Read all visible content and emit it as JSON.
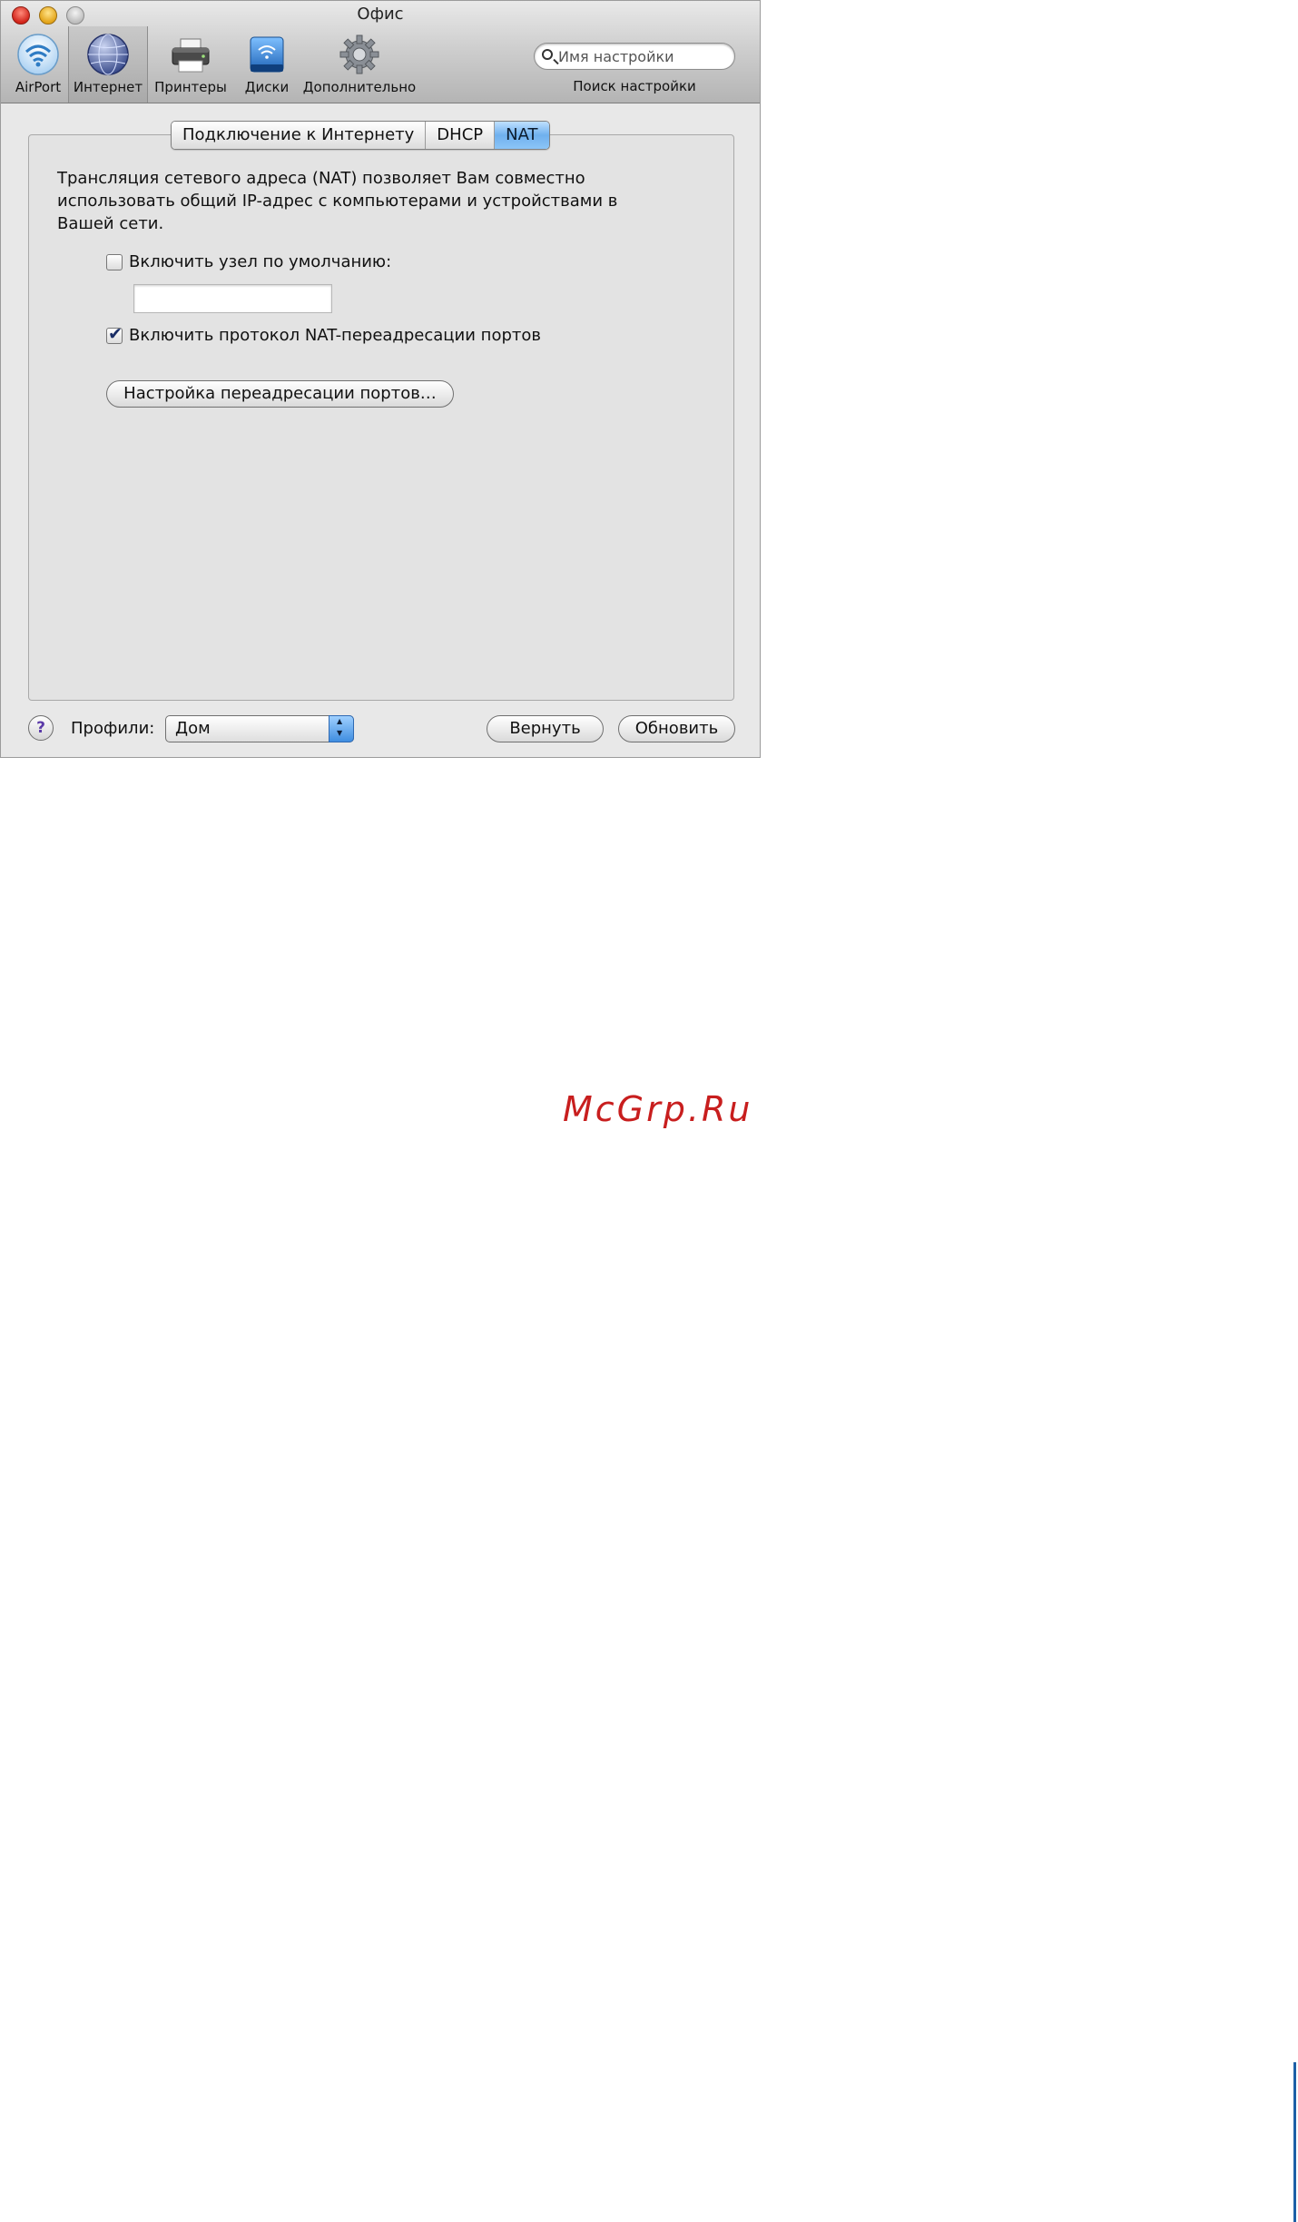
{
  "window": {
    "title": "Офис"
  },
  "toolbar": {
    "items": [
      {
        "label": "AirPort",
        "icon": "airport-wifi-icon"
      },
      {
        "label": "Интернет",
        "icon": "globe-icon",
        "active": true
      },
      {
        "label": "Принтеры",
        "icon": "printer-icon"
      },
      {
        "label": "Диски",
        "icon": "disk-icon"
      },
      {
        "label": "Дополнительно",
        "icon": "gear-icon"
      }
    ],
    "search": {
      "placeholder": "Имя настройки",
      "caption": "Поиск настройки"
    }
  },
  "tabs": [
    {
      "label": "Подключение к Интернету",
      "active": false
    },
    {
      "label": "DHCP",
      "active": false
    },
    {
      "label": "NAT",
      "active": true
    }
  ],
  "nat": {
    "description": "Трансляция сетевого адреса (NAT) позволяет Вам совместно использовать общий IP-адрес с компьютерами и устройствами в Вашей сети.",
    "default_host_label": "Включить узел по умолчанию:",
    "default_host_checked": false,
    "default_host_value": "",
    "port_mapping_label": "Включить протокол NAT-переадресации портов",
    "port_mapping_checked": true,
    "port_forwarding_button": "Настройка переадресации портов…"
  },
  "footer": {
    "help": "?",
    "profiles_label": "Профили:",
    "profile_selected": "Дом",
    "revert_button": "Вернуть",
    "update_button": "Обновить"
  },
  "watermark": "McGrp.Ru",
  "colors": {
    "active_tab": "#6fb0ee",
    "watermark": "#c81e1e",
    "page_rule": "#1d5fa6"
  }
}
